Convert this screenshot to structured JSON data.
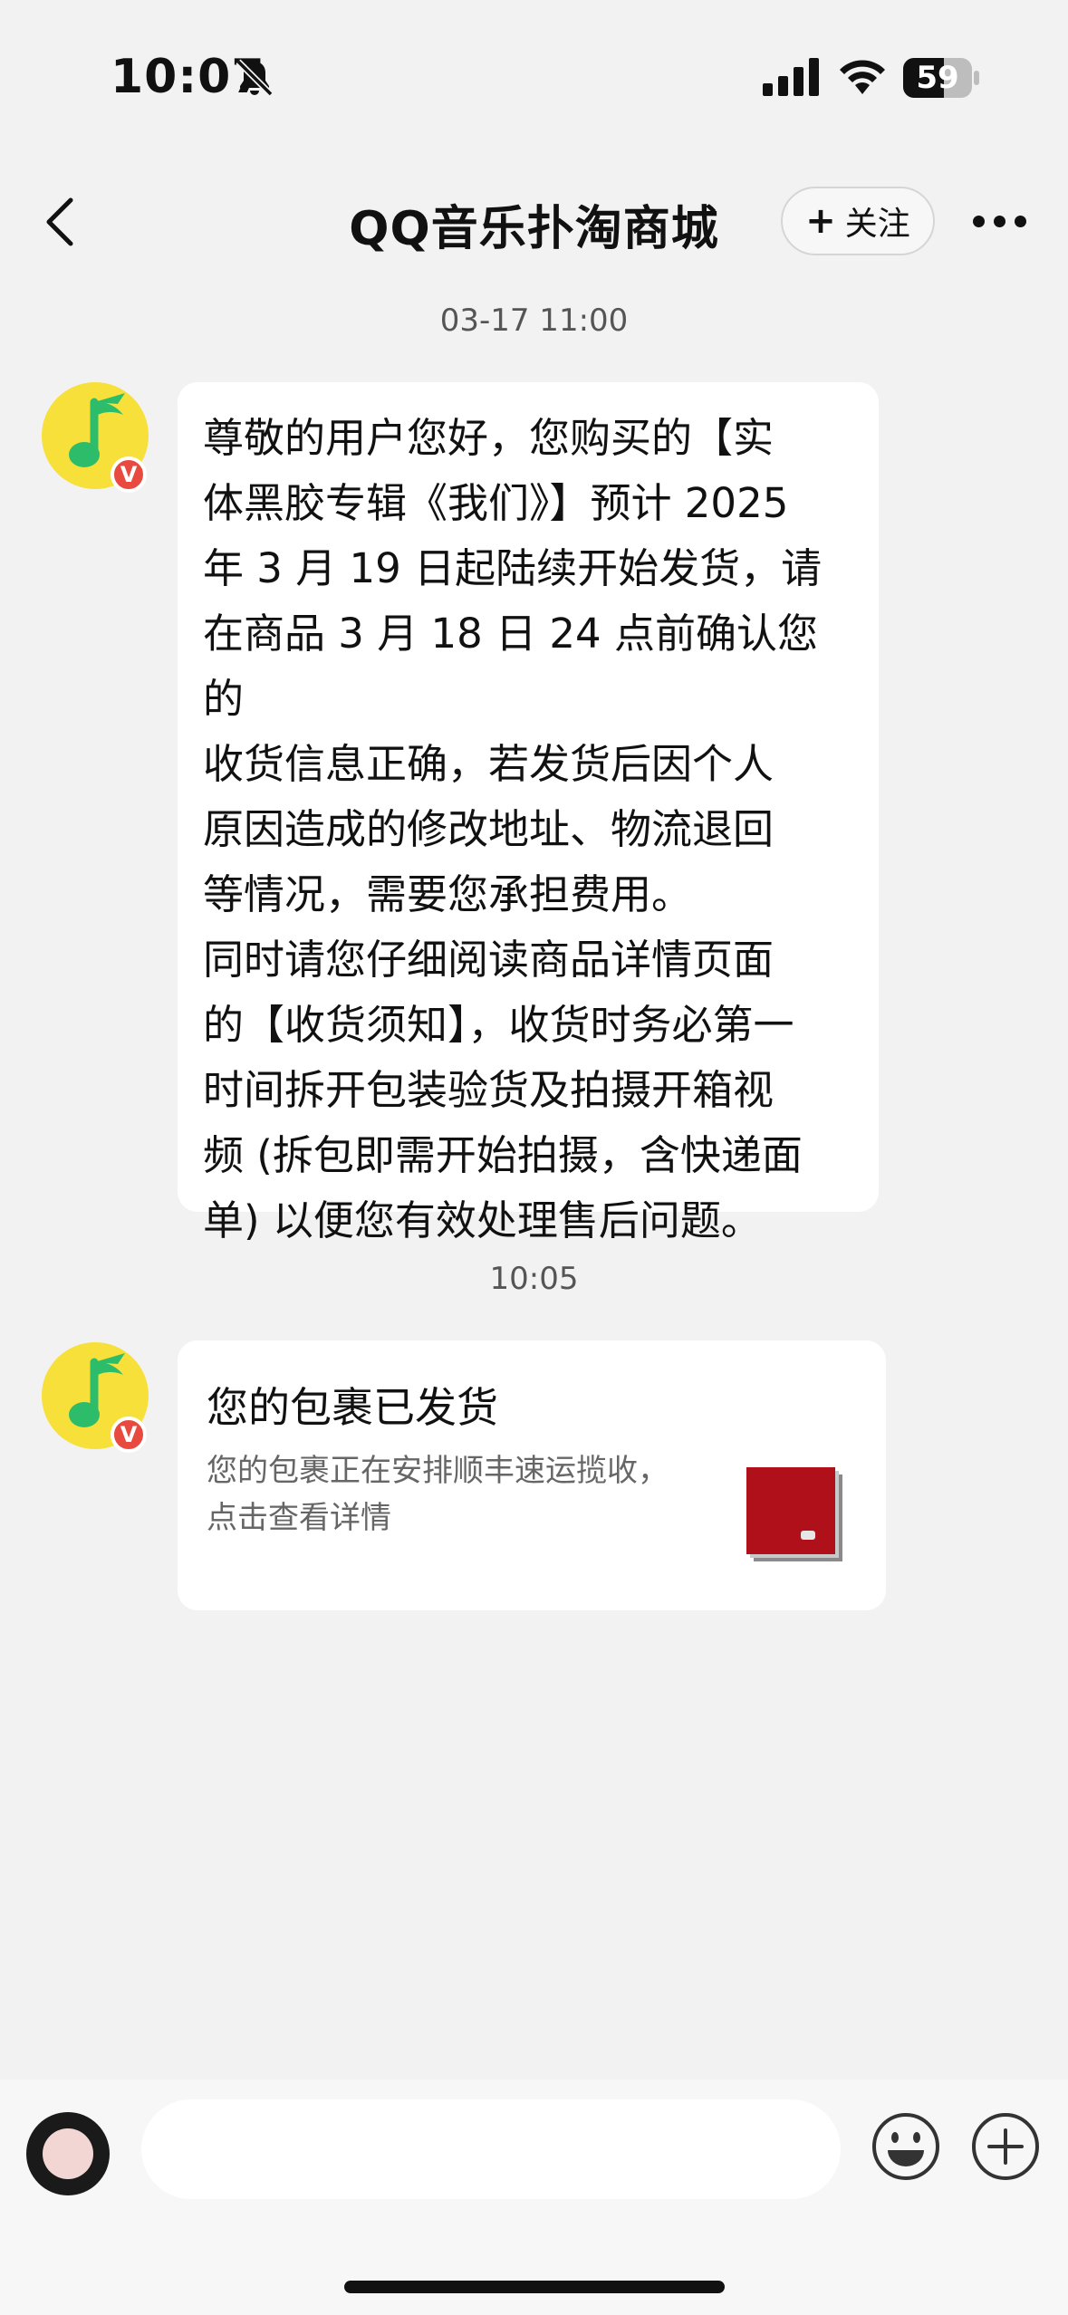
{
  "status": {
    "time": "10:07",
    "battery": "59",
    "battery_level": 0.59,
    "icons": [
      "bell-slash-icon",
      "signal-icon",
      "wifi-icon",
      "battery-icon"
    ]
  },
  "nav": {
    "title": "QQ音乐扑淘商城",
    "follow_label": "关注",
    "icons": [
      "back-arrow-icon",
      "plus-icon",
      "more-icon"
    ]
  },
  "messages": [
    {
      "timestamp": "03-17 11:00",
      "text": "尊敬的用户您好，您购买的【实\n体黑胶专辑《我们》】预计 2025\n年 3 月 19 日起陆续开始发货，请\n在商品 3 月 18 日 24 点前确认您的\n收货信息正确，若发货后因个人\n原因造成的修改地址、物流退回\n等情况，需要您承担费用。\n同时请您仔细阅读商品详情页面\n的【收货须知】，收货时务必第一\n时间拆开包装验货及拍摄开箱视\n频 (拆包即需开始拍摄，含快递面\n单) 以便您有效处理售后问题。"
    },
    {
      "timestamp": "10:05",
      "card_title": "您的包裹已发货",
      "card_desc": "您的包裹正在安排顺丰速运揽收，\n点击查看详情"
    }
  ],
  "sender": {
    "badge": "V",
    "icons": [
      "qq-music-logo-icon",
      "verified-badge-icon"
    ]
  },
  "input_bar": {
    "icons": [
      "emoji-icon",
      "add-icon"
    ]
  },
  "colors": {
    "background": "#f2f2f2",
    "bubble": "#ffffff",
    "avatar_yellow": "#f7e03a",
    "logo_green": "#2dbd6a",
    "badge_red": "#e84a3f",
    "thumb_red": "#b0101a"
  }
}
